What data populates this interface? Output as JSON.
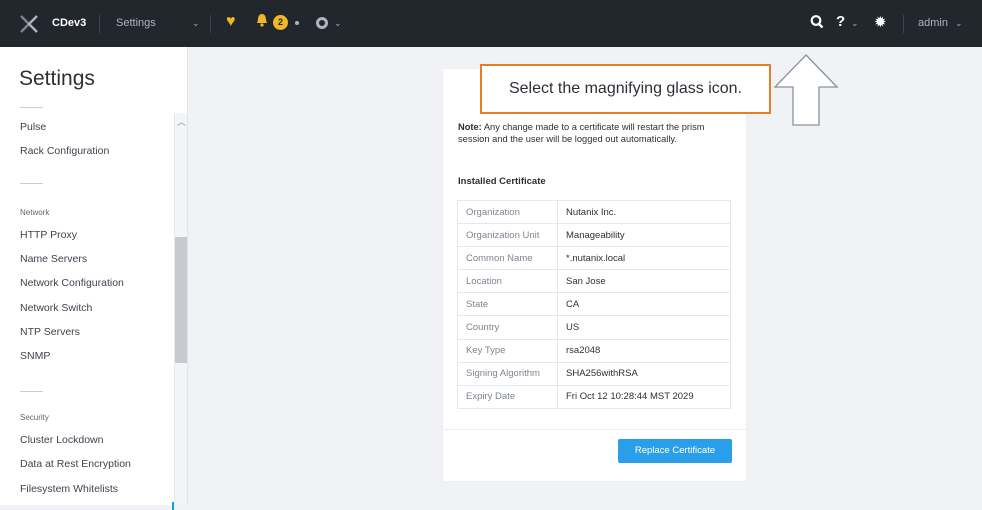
{
  "header": {
    "cluster_name": "CDev3",
    "page_selector": "Settings",
    "alert_count": "2",
    "user_label": "admin"
  },
  "sidebar": {
    "title": "Settings",
    "group1": [
      "Pulse",
      "Rack Configuration"
    ],
    "network_heading": "Network",
    "network_items": [
      "HTTP Proxy",
      "Name Servers",
      "Network Configuration",
      "Network Switch",
      "NTP Servers",
      "SNMP"
    ],
    "security_heading": "Security",
    "security_items": [
      "Cluster Lockdown",
      "Data at Rest Encryption",
      "Filesystem Whitelists"
    ]
  },
  "panel": {
    "note_label": "Note:",
    "note_text": " Any change made to a certificate will restart the prism session and the user will be logged out automatically.",
    "installed_heading": "Installed Certificate",
    "rows": [
      {
        "key": "Organization",
        "value": "Nutanix Inc."
      },
      {
        "key": "Organization Unit",
        "value": "Manageability"
      },
      {
        "key": "Common Name",
        "value": "*.nutanix.local"
      },
      {
        "key": "Location",
        "value": "San Jose"
      },
      {
        "key": "State",
        "value": "CA"
      },
      {
        "key": "Country",
        "value": "US"
      },
      {
        "key": "Key Type",
        "value": "rsa2048"
      },
      {
        "key": "Signing Algorithm",
        "value": "SHA256withRSA"
      },
      {
        "key": "Expiry Date",
        "value": "Fri Oct 12 10:28:44 MST 2029"
      }
    ],
    "replace_button": "Replace Certificate"
  },
  "callout": {
    "text": "Select the magnifying glass icon."
  },
  "colors": {
    "topbar": "#22272e",
    "accent": "#2a9ee8",
    "warning": "#f0b823",
    "callout_border": "#e77d25"
  }
}
